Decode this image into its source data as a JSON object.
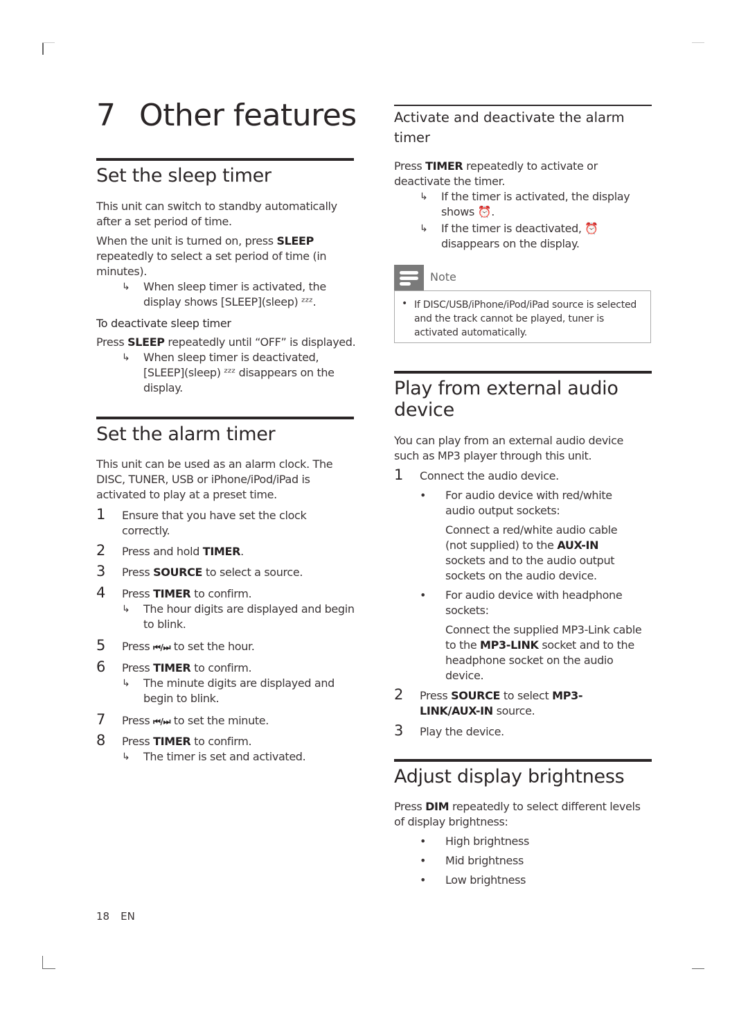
{
  "page": {
    "chapter_number": "7",
    "chapter_title": "Other features",
    "footer": {
      "page_number": "18",
      "language": "EN"
    }
  },
  "sleep_timer": {
    "heading": "Set the sleep timer",
    "intro": "This unit can switch to standby automatically after a set period of time.",
    "instruction_pre": "When the unit is turned on, press ",
    "instruction_key": "SLEEP",
    "instruction_post": " repeatedly to select a set period of time (in minutes).",
    "result_activated": "When sleep timer is activated, the display shows [SLEEP](sleep) ᶻᶻᶻ.",
    "deactivate_heading": "To deactivate sleep timer",
    "deactivate_pre": "Press ",
    "deactivate_key": "SLEEP",
    "deactivate_post": " repeatedly until “OFF” is displayed.",
    "result_deactivated": "When sleep timer is deactivated, [SLEEP](sleep) ᶻᶻᶻ disappears on the display."
  },
  "alarm_timer": {
    "heading": "Set the alarm timer",
    "intro": "This unit can be used as an alarm clock. The DISC, TUNER, USB or iPhone/iPod/iPad is activated to play at a preset time.",
    "steps": [
      {
        "num": "1",
        "pre": "Ensure that you have set the clock correctly.",
        "key": "",
        "post": ""
      },
      {
        "num": "2",
        "pre": "Press and hold ",
        "key": "TIMER",
        "post": "."
      },
      {
        "num": "3",
        "pre": "Press ",
        "key": "SOURCE",
        "post": " to select a source."
      },
      {
        "num": "4",
        "pre": "Press ",
        "key": "TIMER",
        "post": " to confirm.",
        "result": "The hour digits are displayed and begin to blink."
      },
      {
        "num": "5",
        "pre": "Press ",
        "key": "⏮/⏭",
        "post": " to set the hour."
      },
      {
        "num": "6",
        "pre": "Press ",
        "key": "TIMER",
        "post": " to confirm.",
        "result": "The minute digits are displayed and begin to blink."
      },
      {
        "num": "7",
        "pre": "Press ",
        "key": "⏮/⏭",
        "post": " to set the minute."
      },
      {
        "num": "8",
        "pre": "Press ",
        "key": "TIMER",
        "post": " to confirm.",
        "result": "The timer is set and activated."
      }
    ]
  },
  "activate_alarm": {
    "heading": "Activate and deactivate the alarm timer",
    "instruction_pre": "Press ",
    "instruction_key": "TIMER",
    "instruction_post": " repeatedly to activate or deactivate the timer.",
    "result_activated": "If the timer is activated, the display shows ⏰.",
    "result_deactivated": "If the timer is deactivated, ⏰ disappears on the display."
  },
  "note": {
    "label": "Note",
    "items": [
      "If DISC/USB/iPhone/iPod/iPad source is selected and the track cannot be played, tuner is activated automatically."
    ]
  },
  "external_audio": {
    "heading": "Play from external audio device",
    "intro": "You can play from an external audio device such as MP3 player through this unit.",
    "step1": "Connect the audio device.",
    "bullet1": "For audio device with red/white audio output sockets:",
    "bullet1_detail_pre": "Connect a red/white audio cable (not supplied) to the ",
    "bullet1_detail_key": "AUX-IN",
    "bullet1_detail_post": " sockets and to the audio output sockets on the audio device.",
    "bullet2": "For audio device with headphone sockets:",
    "bullet2_detail_pre": "Connect the supplied MP3-Link cable to the ",
    "bullet2_detail_key": "MP3-LINK",
    "bullet2_detail_post": " socket and to the headphone socket on the audio device.",
    "step2_pre": "Press ",
    "step2_key": "SOURCE",
    "step2_mid": " to select ",
    "step2_key2": "MP3-LINK/AUX-IN",
    "step2_post": " source.",
    "step3": "Play the device."
  },
  "brightness": {
    "heading": "Adjust display brightness",
    "instruction_pre": "Press ",
    "instruction_key": "DIM",
    "instruction_post": " repeatedly to select different levels of display brightness:",
    "levels": [
      "High brightness",
      "Mid brightness",
      "Low brightness"
    ]
  },
  "glyphs": {
    "arrow": "↳",
    "bullet": "•"
  }
}
